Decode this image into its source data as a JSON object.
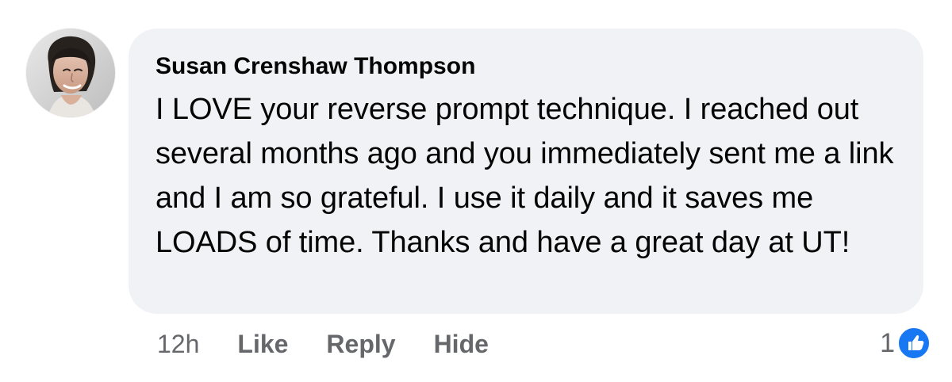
{
  "comment": {
    "author": "Susan Crenshaw Thompson",
    "text": "I LOVE your reverse prompt technique. I reached out several months ago and you immediately sent me a link and I am so grateful. I use it daily and it saves me LOADS of time. Thanks and have a great day at UT!",
    "timestamp": "12h",
    "actions": {
      "like_label": "Like",
      "reply_label": "Reply",
      "hide_label": "Hide"
    },
    "reactions": {
      "count": "1",
      "icon": "like-reaction-icon",
      "color": "#1877f2"
    }
  },
  "colors": {
    "bubble": "#f0f2f5",
    "primary_text": "#050505",
    "secondary_text": "#65676b",
    "accent": "#1877f2"
  },
  "icons": {
    "avatar": "profile-photo-avatar",
    "reaction": "thumbs-up-icon"
  }
}
